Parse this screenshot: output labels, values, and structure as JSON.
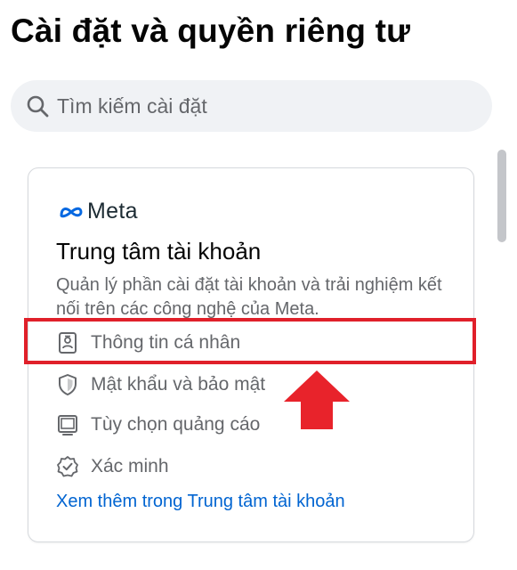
{
  "header": {
    "title": "Cài đặt và quyền riêng tư"
  },
  "search": {
    "placeholder": "Tìm kiếm cài đặt",
    "icon": "search-icon"
  },
  "accounts_center": {
    "brand": "Meta",
    "title": "Trung tâm tài khoản",
    "description": "Quản lý phần cài đặt tài khoản và trải nghiệm kết nối trên các công nghệ của Meta.",
    "items": [
      {
        "label": "Thông tin cá nhân",
        "icon": "id-card-icon"
      },
      {
        "label": "Mật khẩu và bảo mật",
        "icon": "shield-icon"
      },
      {
        "label": "Tùy chọn quảng cáo",
        "icon": "monitor-icon"
      },
      {
        "label": "Xác minh",
        "icon": "verified-badge-icon"
      }
    ],
    "see_more": "Xem thêm trong Trung tâm tài khoản"
  },
  "annotation": {
    "highlight_color": "#e0202a",
    "arrow_color": "#e8232b",
    "highlighted_item": "Thông tin cá nhân"
  },
  "colors": {
    "link": "#0064d1",
    "secondary_text": "#65676b",
    "search_bg": "#f0f2f5",
    "meta_blue": "#0668e1"
  }
}
